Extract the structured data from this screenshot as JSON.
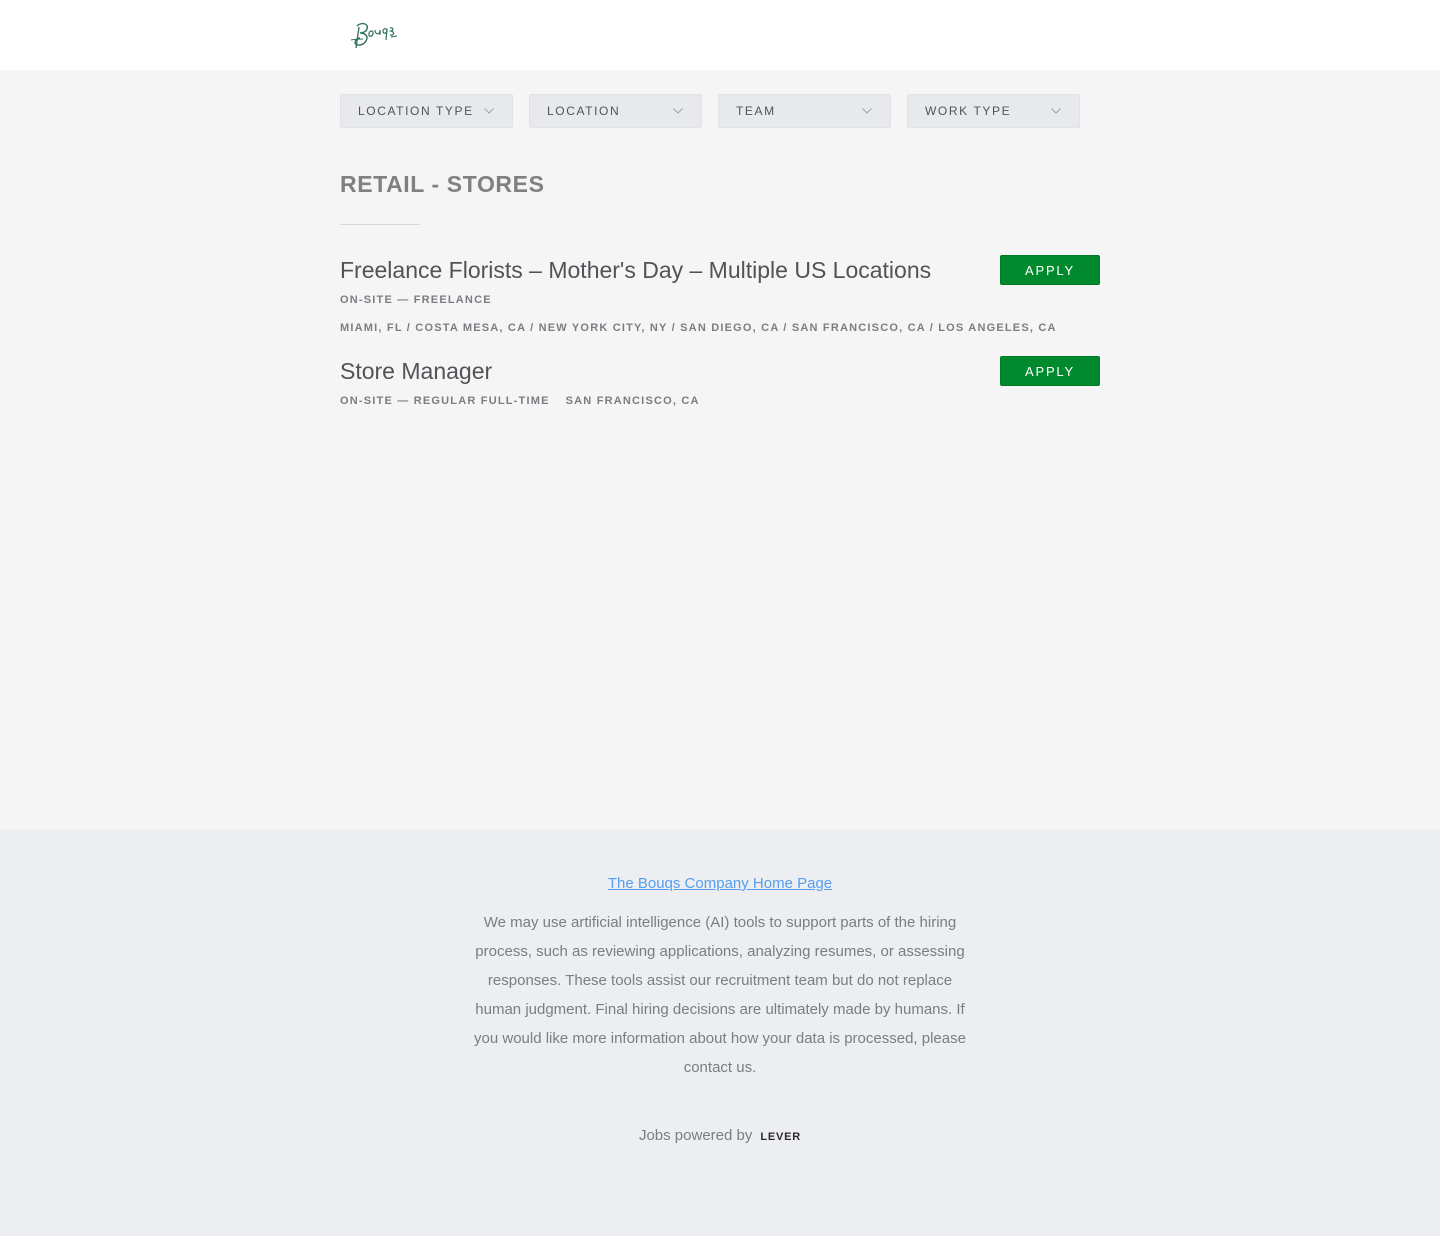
{
  "header": {
    "logo_text": "Bouqs"
  },
  "filters": [
    {
      "label": "LOCATION TYPE"
    },
    {
      "label": "LOCATION"
    },
    {
      "label": "TEAM"
    },
    {
      "label": "WORK TYPE"
    }
  ],
  "section": {
    "title": "RETAIL - STORES"
  },
  "postings": [
    {
      "title": "Freelance Florists – Mother's Day – Multiple US Locations",
      "apply_label": "APPLY",
      "workplace": "ON-SITE — FREELANCE",
      "locations": "MIAMI, FL / COSTA MESA, CA / NEW YORK CITY, NY / SAN DIEGO, CA / SAN FRANCISCO, CA / LOS ANGELES, CA"
    },
    {
      "title": "Store Manager",
      "apply_label": "APPLY",
      "workplace": "ON-SITE — REGULAR FULL-TIME",
      "locations": "SAN FRANCISCO, CA"
    }
  ],
  "footer": {
    "home_link": "The Bouqs Company Home Page",
    "disclaimer": "We may use artificial intelligence (AI) tools to support parts of the hiring process, such as reviewing applications, analyzing resumes, or assessing responses. These tools assist our recruitment team but do not replace human judgment. Final hiring decisions are ultimately made by humans. If you would like more information about how your data is processed, please contact us.",
    "powered_by": "Jobs powered by",
    "lever_label": "LEVER"
  },
  "colors": {
    "apply_green": "#008a2d",
    "link_blue": "#579eee",
    "logo_green": "#2f6e5b"
  }
}
